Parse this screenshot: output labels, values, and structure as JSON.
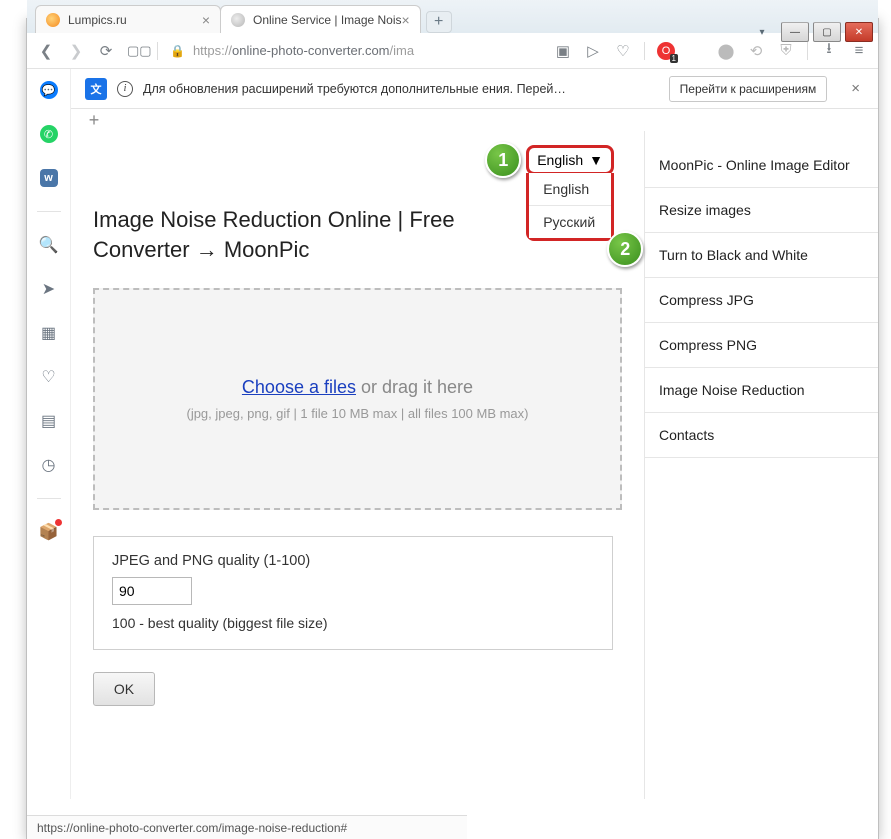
{
  "window": {
    "tabs": [
      {
        "title": "Lumpics.ru"
      },
      {
        "title": "Online Service | Image Nois"
      }
    ]
  },
  "address": {
    "url_prefix": "https://",
    "url_host": "online-photo-converter.com",
    "url_path": "/ima"
  },
  "translate_bar": {
    "text": "Для обновления расширений требуются дополнительные              ения. Перейдите в ме...",
    "button": "Перейти к расширениям"
  },
  "language": {
    "current": "English",
    "options": [
      "English",
      "Русский"
    ]
  },
  "page": {
    "title": "Image Noise Reduction Online | Free Converter → MoonPic",
    "choose_link": "Choose a files",
    "choose_suffix": " or drag it here",
    "dz_hint": "(jpg, jpeg, png, gif | 1 file 10 MB max | all files 100 MB max)",
    "quality_label": "JPEG and PNG quality (1-100)",
    "quality_value": "90",
    "quality_hint": "100 - best quality (biggest file size)",
    "ok": "OK"
  },
  "sidebar": [
    "MoonPic - Online Image Editor",
    "Resize images",
    "Turn to Black and White",
    "Compress JPG",
    "Compress PNG",
    "Image Noise Reduction",
    "Contacts"
  ],
  "status_url": "https://online-photo-converter.com/image-noise-reduction#",
  "steps": {
    "s1": "1",
    "s2": "2"
  }
}
